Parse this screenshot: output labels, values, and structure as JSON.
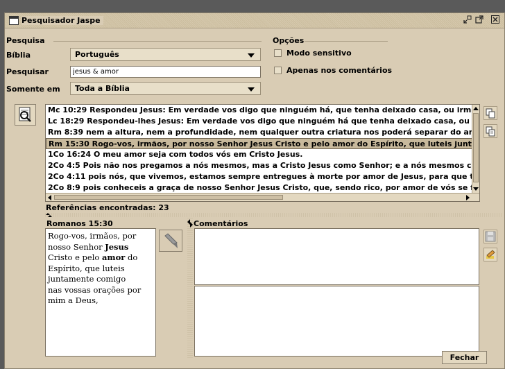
{
  "window": {
    "title": "Pesquisador Jaspe",
    "controls": {
      "minimize": "⌐",
      "maximize": "⧉",
      "close": "☒"
    }
  },
  "search": {
    "section_label": "Pesquisa",
    "bible_label": "Bíblia",
    "bible_value": "Português",
    "query_label": "Pesquisar",
    "query_value": "jesus & amor",
    "scope_label": "Somente em",
    "scope_value": "Toda a Bíblia"
  },
  "options": {
    "section_label": "Opções",
    "case_sensitive_label": "Modo sensitivo",
    "case_sensitive_checked": false,
    "comments_only_label": "Apenas nos comentários",
    "comments_only_checked": false
  },
  "results": {
    "rows": [
      "Mc 10:29 Respondeu Jesus: Em verdade vos digo que ninguém há, que tenha deixado casa, ou irmãos, ou",
      "Lc 18:29 Respondeu-lhes Jesus: Em verdade vos digo que ninguém há que tenha deixado casa, ou mulhe",
      "Rm 8:39 nem a altura, nem a profundidade, nem qualquer outra criatura nos poderá separar do amor de D",
      "Rm 15:30 Rogo-vos, irmãos, por nosso Senhor Jesus Cristo e pelo amor do Espírito, que luteis juntamen",
      "1Co 16:24 O meu amor seja com todos vós em Cristo Jesus.",
      "2Co 4:5 Pois não nos pregamos a nós mesmos, mas a Cristo Jesus como Senhor; e a nós mesmos como",
      "2Co 4:11 pois nós, que vivemos, estamos sempre entregues à morte por amor de Jesus, para que també",
      "2Co 8:9 pois conheceis a graça de nosso Senhor Jesus Cristo, que, sendo rico, por amor de vós se fez po"
    ],
    "selected_index": 3,
    "count_label": "Referências encontradas: 23"
  },
  "verse": {
    "reference": "Romanos 15:30",
    "lines": [
      "Rogo-vos, irmãos, por",
      "nosso Senhor ",
      "Cristo e pelo ",
      " do",
      "Espírito, que luteis",
      "juntamente comigo",
      "nas vossas orações por",
      "mim a Deus,"
    ],
    "highlight_jesus": "Jesus",
    "highlight_amor": "amor"
  },
  "comments": {
    "title": "Comentários"
  },
  "footer": {
    "close_label": "Fechar"
  },
  "colors": {
    "window_bg": "#d9ccb4",
    "selected_row": "#c8b99c"
  }
}
